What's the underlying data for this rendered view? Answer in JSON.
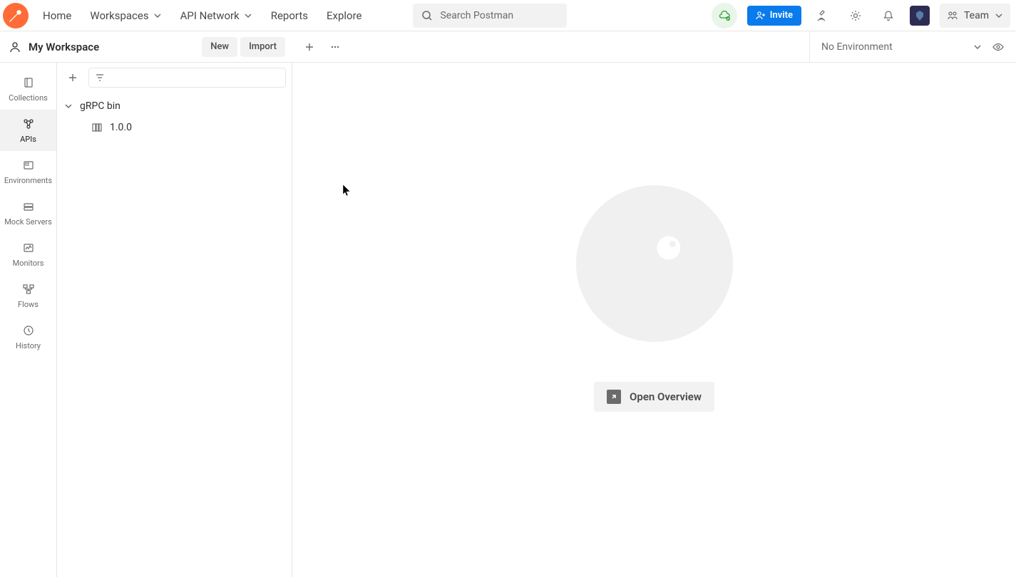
{
  "header": {
    "nav": {
      "home": "Home",
      "workspaces": "Workspaces",
      "api_network": "API Network",
      "reports": "Reports",
      "explore": "Explore"
    },
    "search_placeholder": "Search Postman",
    "invite": "Invite",
    "team": "Team"
  },
  "workspace_bar": {
    "name": "My Workspace",
    "new_btn": "New",
    "import_btn": "Import",
    "environment": "No Environment"
  },
  "rail": {
    "collections": "Collections",
    "apis": "APIs",
    "environments": "Environments",
    "mock_servers": "Mock Servers",
    "monitors": "Monitors",
    "flows": "Flows",
    "history": "History"
  },
  "tree": {
    "api_name": "gRPC bin",
    "version": "1.0.0"
  },
  "main": {
    "open_overview": "Open Overview"
  }
}
